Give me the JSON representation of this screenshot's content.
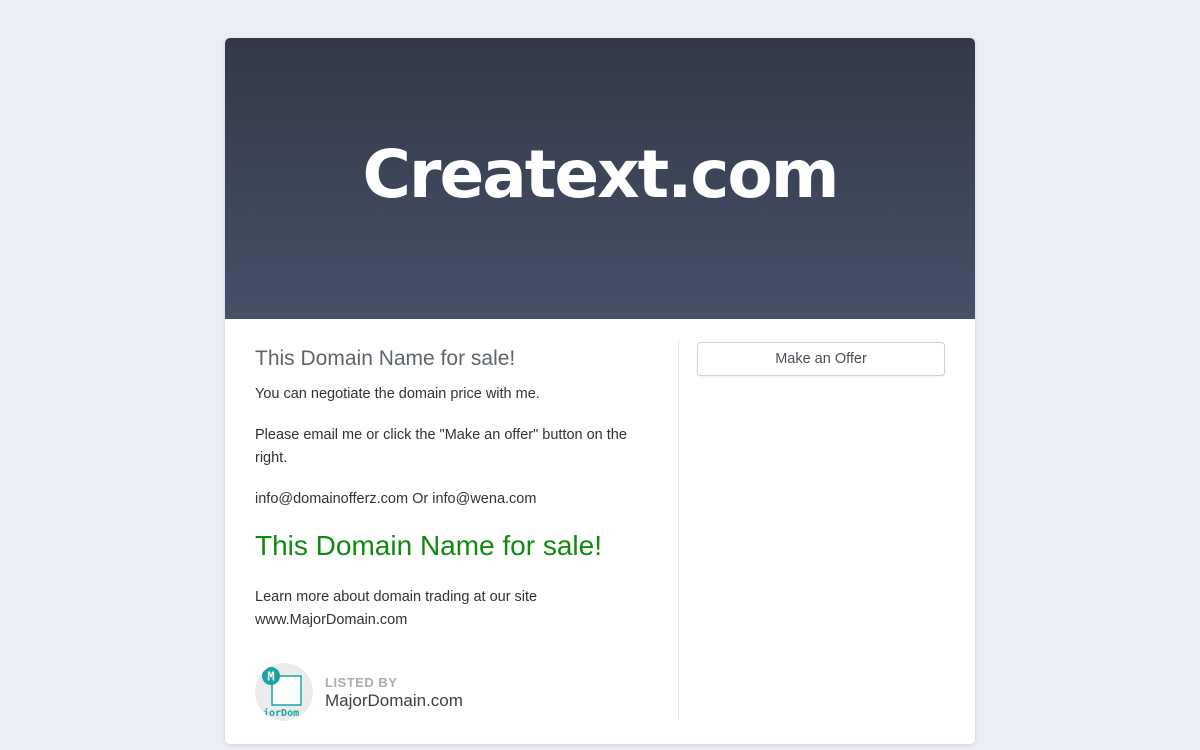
{
  "hero": {
    "title": "Creatext.com"
  },
  "main": {
    "heading": "This Domain Name for sale!",
    "negotiate_text": "You can negotiate the domain price with me.",
    "email_prompt": "Please email me or click the \"Make an offer\" button on the right.",
    "contact_emails": "info@domainofferz.com Or info@wena.com",
    "sale_banner": "This Domain Name for sale!",
    "learn_more_line1": "Learn more about domain trading at our site",
    "learn_more_line2": "www.MajorDomain.com"
  },
  "listing": {
    "label": "LISTED BY",
    "name": "MajorDomain.com",
    "logo_badge": "M",
    "logo_text": "jorDom"
  },
  "sidebar": {
    "offer_button_label": "Make an Offer"
  },
  "colors": {
    "background": "#ebeef5",
    "hero_gradient_top": "#333848",
    "hero_gradient_bottom": "#465168",
    "sale_green": "#118a11",
    "logo_teal": "#1aa3a3"
  }
}
